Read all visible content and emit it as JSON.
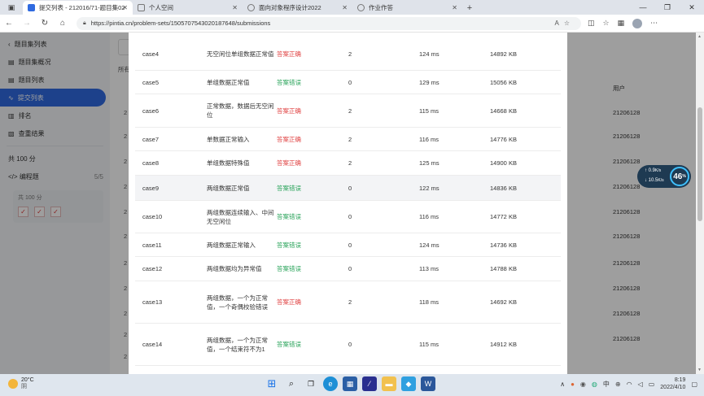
{
  "browser": {
    "tabs": [
      {
        "title": "提交列表 - 212016/71-题目集02",
        "active": true,
        "color": "#2f6ae0"
      },
      {
        "title": "个人空间",
        "active": false,
        "color": "#888888"
      },
      {
        "title": "面向对象程序设计2022",
        "active": false,
        "color": "#888888"
      },
      {
        "title": "作业作答",
        "active": false,
        "color": "#888888"
      }
    ],
    "url": "https://pintia.cn/problem-sets/1505707543020187648/submissions"
  },
  "sidebar": {
    "back_label": "题目集列表",
    "items": [
      {
        "label": "题目集概况",
        "active": false
      },
      {
        "label": "题目列表",
        "active": false
      },
      {
        "label": "提交列表",
        "active": true
      },
      {
        "label": "排名",
        "active": false
      },
      {
        "label": "查重结果",
        "active": false
      }
    ],
    "total_label": "共 100 分",
    "programming_label": "编程题",
    "programming_count": "5/5",
    "card_total_label": "共 100 分"
  },
  "background": {
    "left_label": "所有",
    "user_header": "用户",
    "user_ids": [
      "21206128",
      "21206128",
      "21206128",
      "21206128",
      "21206128",
      "21206128",
      "21206128",
      "21206128",
      "21206128",
      "21206128"
    ],
    "left_nums": [
      "2",
      "2",
      "2",
      "2",
      "2",
      "2",
      "2",
      "2",
      "2",
      "2",
      "2"
    ]
  },
  "results": [
    {
      "case": "case4",
      "name": "无空闲位单组数据正常值",
      "result": "答案正确",
      "status": "ok",
      "score": "2",
      "time": "124 ms",
      "memory": "14892 KB"
    },
    {
      "case": "case5",
      "name": "单组数据正常值",
      "result": "答案错误",
      "status": "bad",
      "score": "0",
      "time": "129 ms",
      "memory": "15056 KB"
    },
    {
      "case": "case6",
      "name": "正常数据，数据后无空闲位",
      "result": "答案正确",
      "status": "ok",
      "score": "2",
      "time": "115 ms",
      "memory": "14668 KB"
    },
    {
      "case": "case7",
      "name": "单数据正常输入",
      "result": "答案正确",
      "status": "ok",
      "score": "2",
      "time": "116 ms",
      "memory": "14776 KB"
    },
    {
      "case": "case8",
      "name": "单组数据特殊值",
      "result": "答案正确",
      "status": "ok",
      "score": "2",
      "time": "125 ms",
      "memory": "14900 KB"
    },
    {
      "case": "case9",
      "name": "两组数据正常值",
      "result": "答案错误",
      "status": "bad",
      "score": "0",
      "time": "122 ms",
      "memory": "14836 KB"
    },
    {
      "case": "case10",
      "name": "两组数据连续输入、中间无空闲位",
      "result": "答案错误",
      "status": "bad",
      "score": "0",
      "time": "116 ms",
      "memory": "14772 KB"
    },
    {
      "case": "case11",
      "name": "两组数据正常输入",
      "result": "答案错误",
      "status": "bad",
      "score": "0",
      "time": "124 ms",
      "memory": "14736 KB"
    },
    {
      "case": "case12",
      "name": "两组数据均为异常值",
      "result": "答案错误",
      "status": "bad",
      "score": "0",
      "time": "113 ms",
      "memory": "14788 KB"
    },
    {
      "case": "case13",
      "name": "两组数据，一个为正常值，一个奇偶校验错误",
      "result": "答案正确",
      "status": "ok",
      "score": "2",
      "time": "118 ms",
      "memory": "14692 KB"
    },
    {
      "case": "case14",
      "name": "两组数据，一个为正常值，一个结束符不为1",
      "result": "答案错误",
      "status": "bad",
      "score": "0",
      "time": "115 ms",
      "memory": "14912 KB"
    }
  ],
  "perf_widget": {
    "up": "0.9",
    "down": "10.5",
    "percent": "46"
  },
  "taskbar": {
    "weather_temp": "20°C",
    "weather_desc": "阴",
    "time": "8:19",
    "date": "2022/4/10"
  },
  "colors": {
    "accent": "#2f6ae0",
    "ok_text": "#e04444",
    "bad_text": "#29a35a"
  }
}
